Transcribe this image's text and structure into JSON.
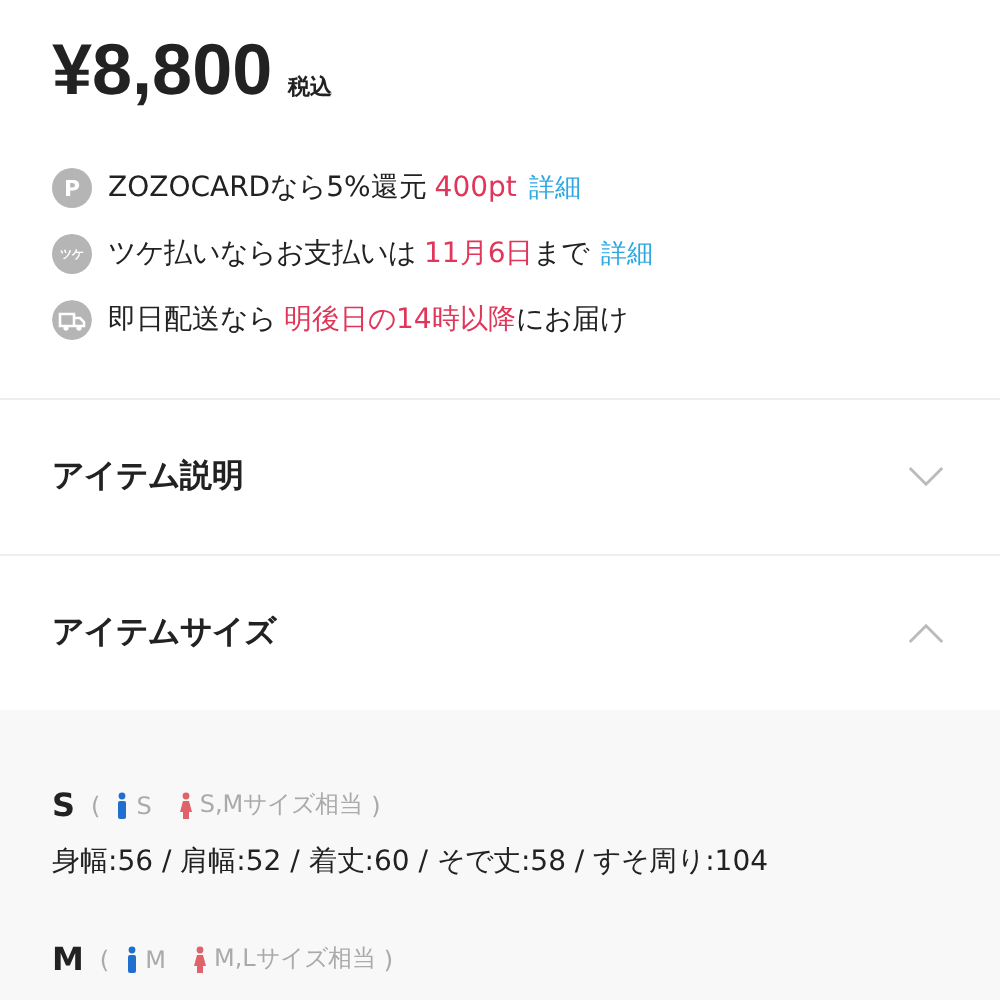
{
  "price": {
    "amount": "¥8,800",
    "tax_note": "税込"
  },
  "perks": [
    {
      "kind": "point",
      "icon_text": "P",
      "segments": [
        {
          "kind": "plain",
          "text": "ZOZOCARDなら5%還元"
        },
        {
          "kind": "highlight",
          "text": "400pt"
        },
        {
          "kind": "link",
          "text": "詳細"
        }
      ]
    },
    {
      "kind": "tsuke",
      "icon_text": "ツケ",
      "segments": [
        {
          "kind": "plain",
          "text": "ツケ払いならお支払いは"
        },
        {
          "kind": "highlight",
          "text": "11月6日"
        },
        {
          "kind": "plain",
          "text": "まで"
        },
        {
          "kind": "link",
          "text": "詳細"
        }
      ]
    },
    {
      "kind": "truck",
      "segments": [
        {
          "kind": "plain",
          "text": "即日配送なら"
        },
        {
          "kind": "highlight",
          "text": "明後日の14時以降"
        },
        {
          "kind": "plain",
          "text": "にお届け"
        }
      ]
    }
  ],
  "sections": [
    {
      "title": "アイテム説明",
      "expanded": false
    },
    {
      "title": "アイテムサイズ",
      "expanded": true
    }
  ],
  "sizes": [
    {
      "label": "S",
      "paren_open": "(",
      "men": "S",
      "women": "S,Mサイズ相当",
      "paren_close": ")",
      "measurements": "身幅:56 / 肩幅:52 / 着丈:60 / そで丈:58 / すそ周り:104"
    },
    {
      "label": "M",
      "paren_open": "(",
      "men": "M",
      "women": "M,Lサイズ相当",
      "paren_close": ")"
    }
  ]
}
